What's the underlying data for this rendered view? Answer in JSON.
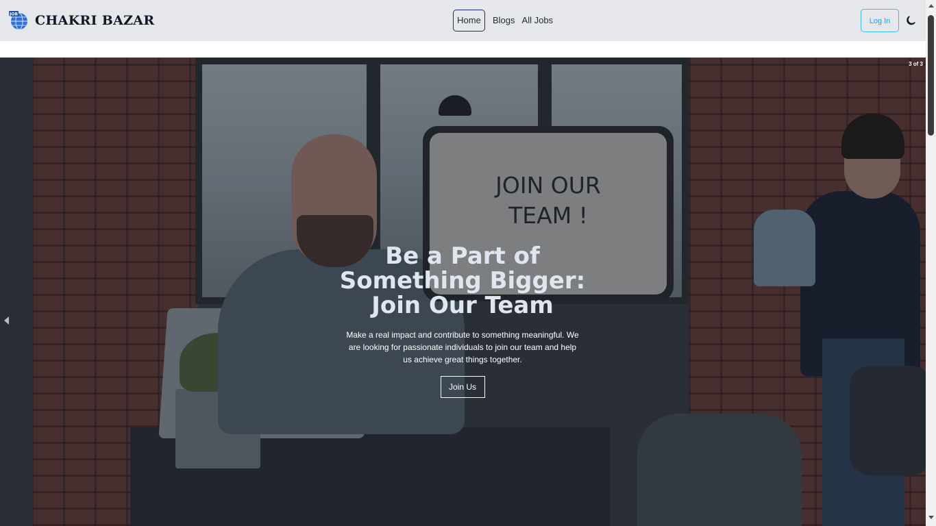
{
  "header": {
    "brand_name": "CHAKRI BAZAR",
    "logo_badge": "JOB",
    "logo_icon": "globe-icon",
    "nav": [
      {
        "label": "Home",
        "active": true
      },
      {
        "label": "Blogs",
        "active": false
      },
      {
        "label": "All Jobs",
        "active": false
      }
    ],
    "login_label": "Log In",
    "theme_icon": "moon-icon"
  },
  "hero": {
    "slide_counter": "3 of 3",
    "title_line1": "Be a Part of",
    "title_line2": "Something Bigger:",
    "title_line3": "Join Our Team",
    "description": "Make a real impact and contribute to something meaningful. We are looking for passionate individuals to join our team and help us achieve great things together.",
    "cta_label": "Join Us",
    "prev_icon": "chevron-left-icon",
    "image_sign_text": "JOIN OUR TEAM !"
  },
  "colors": {
    "navbar_bg": "#e6e7eb",
    "active_border": "#1e2a6b",
    "login_accent": "#0ea5e9",
    "hero_title": "#dfe6ef"
  }
}
